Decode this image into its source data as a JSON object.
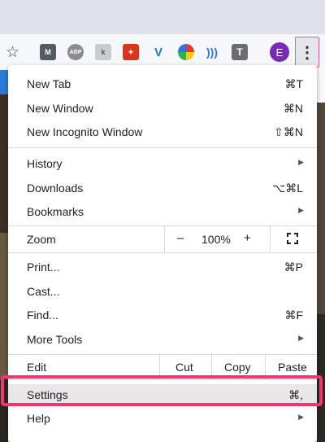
{
  "toolbar": {
    "extensions": [
      {
        "name": "m-extension-icon",
        "glyph": "M",
        "color": "#555b63"
      },
      {
        "name": "abp-icon",
        "glyph": "ABP",
        "color": "#8c8c8c"
      },
      {
        "name": "k-extension-icon",
        "glyph": "k",
        "color": "#c9ccd1"
      },
      {
        "name": "wand-extension-icon",
        "glyph": "✦",
        "color": "#d8371e"
      },
      {
        "name": "v-extension-icon",
        "glyph": "V",
        "color": "#1a7acb"
      },
      {
        "name": "color-wheel-icon",
        "glyph": "●",
        "color": "#2ab04f"
      },
      {
        "name": "broadcast-icon",
        "glyph": "))",
        "color": "#2f73e0"
      },
      {
        "name": "t-extension-icon",
        "glyph": "T",
        "color": "#6d6d6d"
      }
    ],
    "profile_initial": "E"
  },
  "menu": {
    "new_tab": {
      "label": "New Tab",
      "shortcut": "⌘T"
    },
    "new_window": {
      "label": "New Window",
      "shortcut": "⌘N"
    },
    "new_incognito": {
      "label": "New Incognito Window",
      "shortcut": "⇧⌘N"
    },
    "history": {
      "label": "History"
    },
    "downloads": {
      "label": "Downloads",
      "shortcut": "⌥⌘L"
    },
    "bookmarks": {
      "label": "Bookmarks"
    },
    "zoom": {
      "label": "Zoom",
      "minus": "–",
      "value": "100%",
      "plus": "+"
    },
    "print": {
      "label": "Print...",
      "shortcut": "⌘P"
    },
    "cast": {
      "label": "Cast..."
    },
    "find": {
      "label": "Find...",
      "shortcut": "⌘F"
    },
    "more_tools": {
      "label": "More Tools"
    },
    "edit": {
      "label": "Edit",
      "cut": "Cut",
      "copy": "Copy",
      "paste": "Paste"
    },
    "settings": {
      "label": "Settings",
      "shortcut": "⌘,"
    },
    "help": {
      "label": "Help"
    }
  },
  "colors": {
    "highlight": "#f0356f",
    "profile": "#7b2ab8"
  }
}
